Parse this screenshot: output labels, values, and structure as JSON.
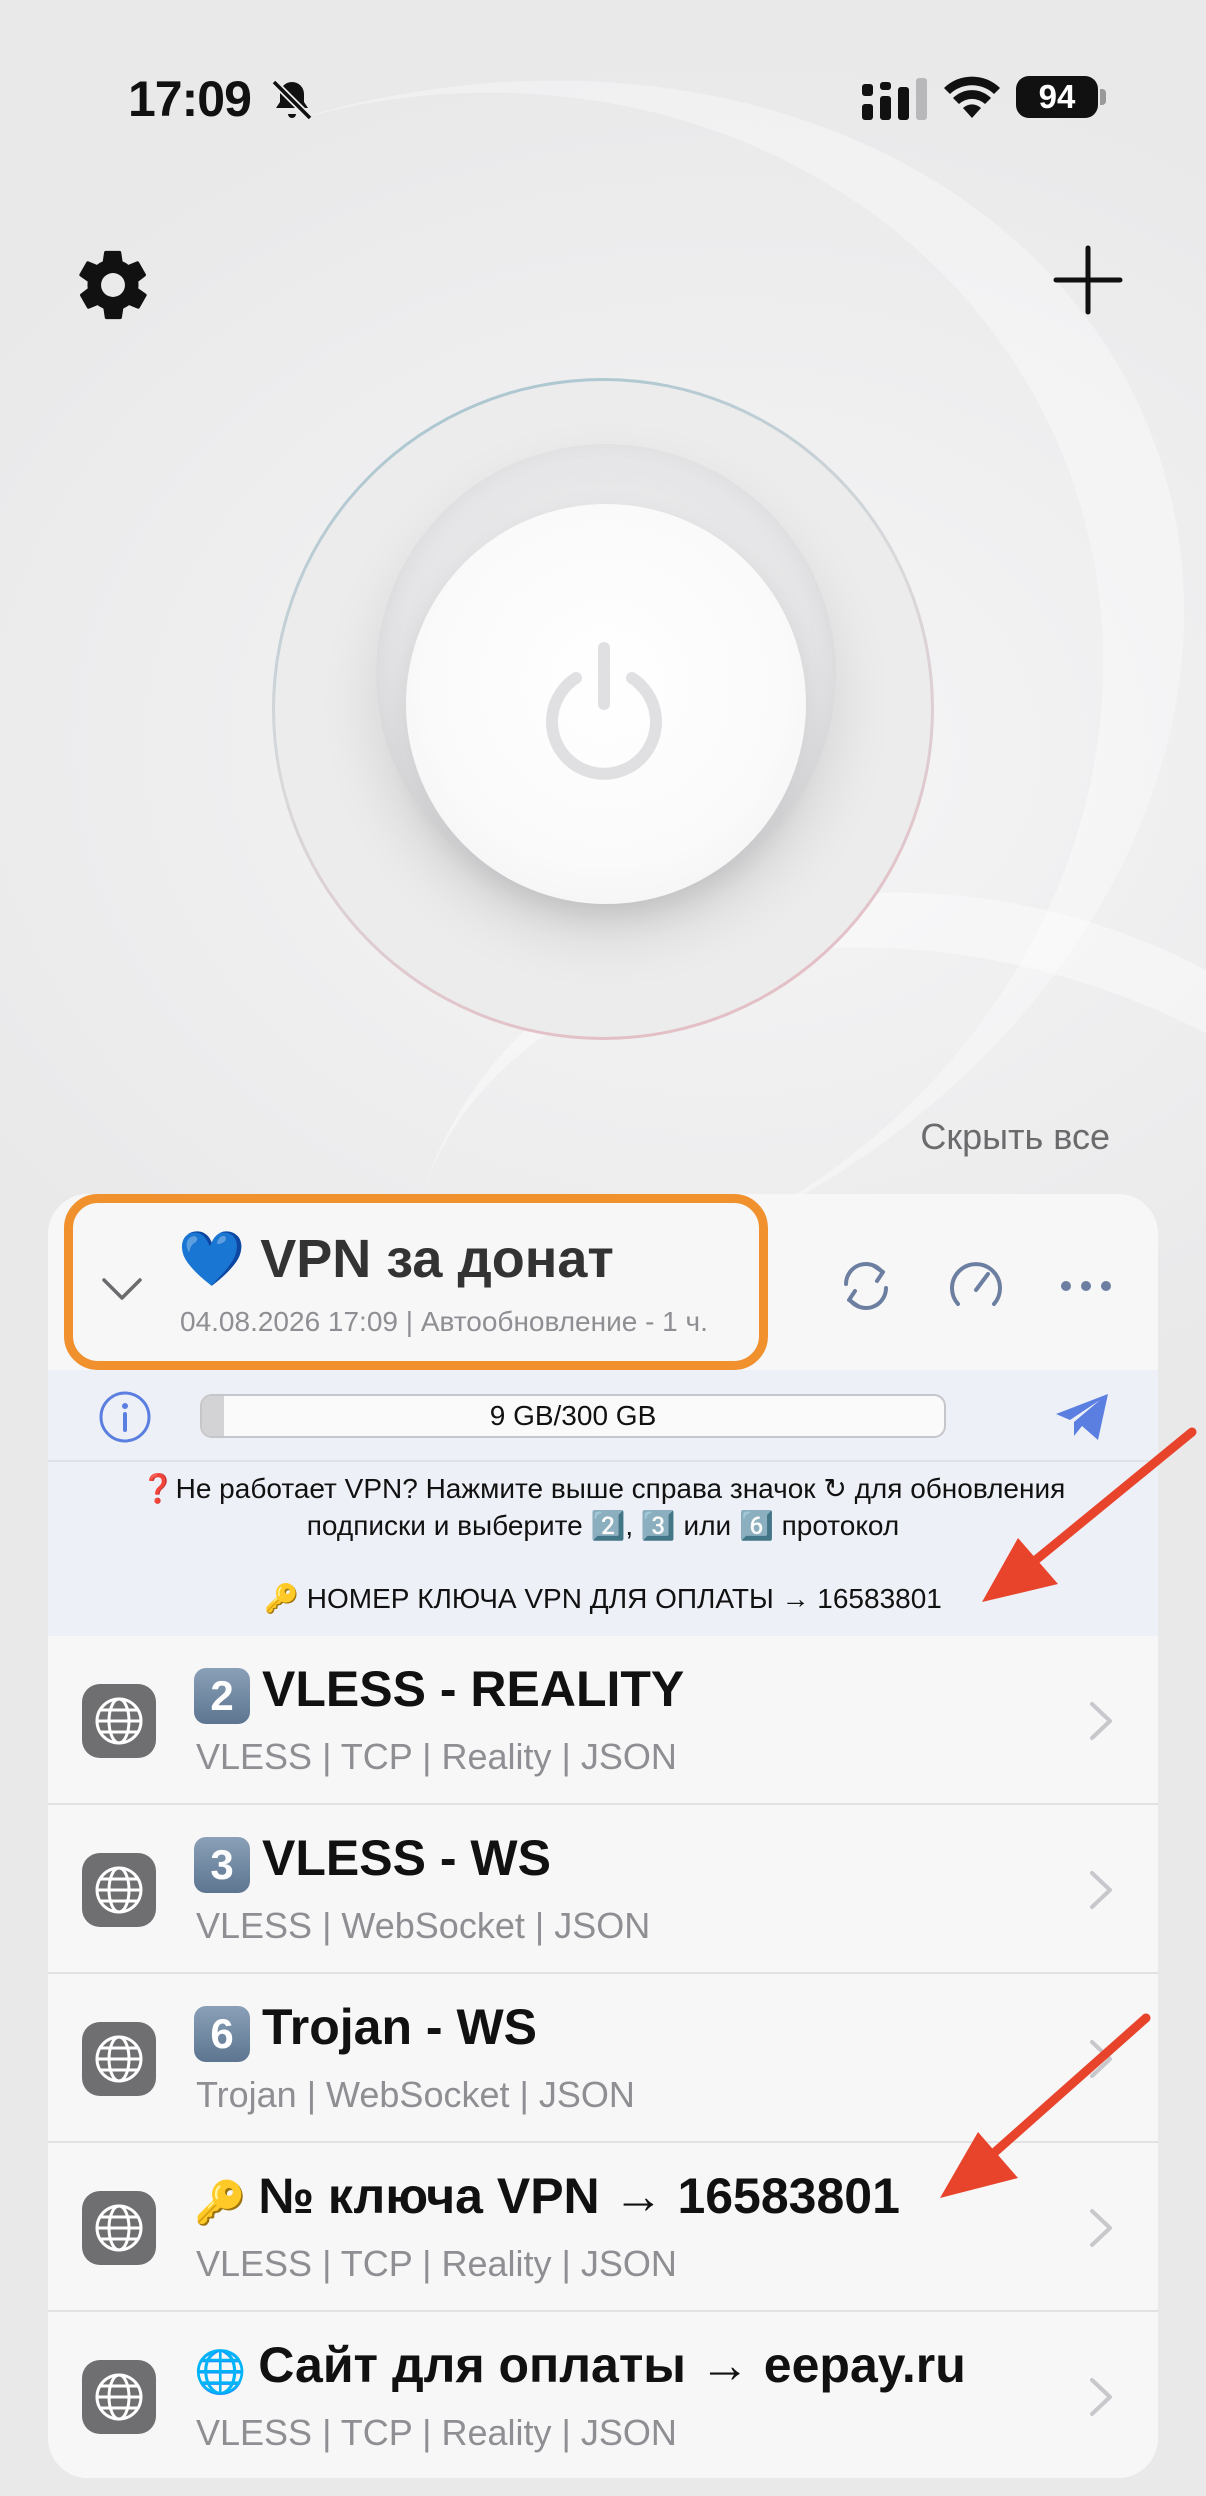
{
  "status_bar": {
    "time": "17:09",
    "battery": "94"
  },
  "main": {
    "hide_all_label": "Скрыть все"
  },
  "subscription": {
    "title": "💙 VPN за донат",
    "meta": "04.08.2026 17:09 | Автообновление - 1 ч.",
    "usage_text": "9 GB/300 GB",
    "usage_fraction": 0.03,
    "notice_line1": "❓Не работает VPN? Нажмите выше справа значок ↻ для обновления",
    "notice_line2": "подписки и выберите 2️⃣, 3️⃣ или 6️⃣ протокол",
    "key_line": "🔑 НОМЕР КЛЮЧА VPN ДЛЯ ОПЛАТЫ → 16583801"
  },
  "servers": [
    {
      "badge": "2",
      "name": "VLESS - REALITY",
      "details": "VLESS | TCP | Reality | JSON"
    },
    {
      "badge": "3",
      "name": "VLESS - WS",
      "details": "VLESS | WebSocket | JSON"
    },
    {
      "badge": "6",
      "name": "Trojan - WS",
      "details": "Trojan | WebSocket | JSON"
    },
    {
      "badge": "🔑",
      "name": "№ ключа VPN → 16583801",
      "details": "VLESS | TCP | Reality | JSON"
    },
    {
      "badge": "🌐",
      "name": "Сайт для оплаты → eepay.ru",
      "details": "VLESS | TCP | Reality | JSON"
    }
  ],
  "colors": {
    "highlight": "#f0912e",
    "accent_blue": "#5b7fe0",
    "annotation_arrow": "#e8442c"
  },
  "icons": [
    "bell-slash-icon",
    "signal-icon",
    "wifi-icon",
    "gear-icon",
    "plus-icon",
    "power-icon",
    "chevron-down-icon",
    "refresh-icon",
    "speedometer-icon",
    "more-icon",
    "info-icon",
    "telegram-icon",
    "globe-icon",
    "chevron-right-icon"
  ]
}
